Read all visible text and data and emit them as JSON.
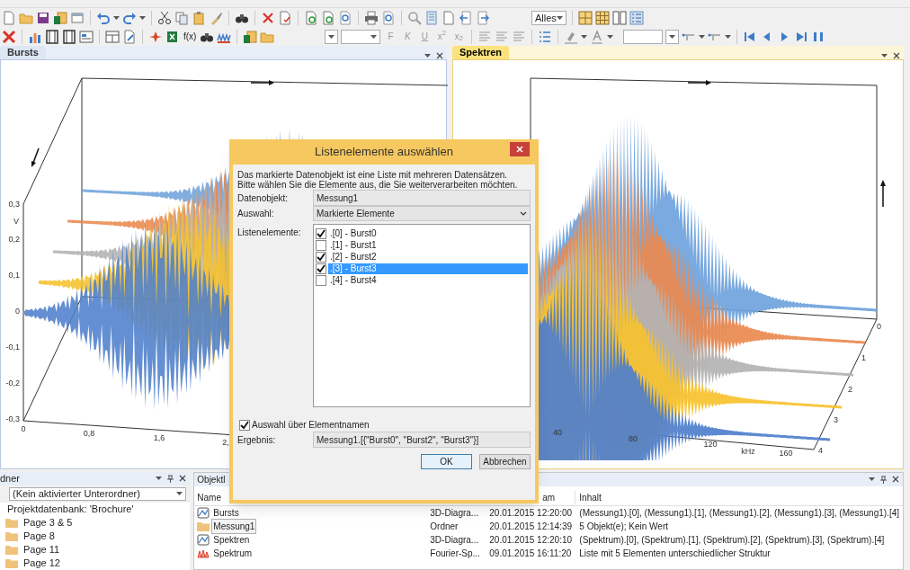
{
  "toolbar": {
    "filter_dropdown": {
      "value": "Alles"
    },
    "format_buttons": [
      "F",
      "K",
      "U",
      "x$^{2}$",
      "x$_{2}$"
    ],
    "function_button": "f(x)"
  },
  "left_panel": {
    "tab": {
      "label": "Bursts",
      "selected": false
    },
    "chart": {
      "y_ticks": [
        "0,3",
        "0,2",
        "0,1",
        "0",
        "-0,1",
        "-0,2",
        "-0,3"
      ],
      "y_unit": "V",
      "x_ticks": [
        "0",
        "0,8",
        "1,6",
        "2,"
      ]
    }
  },
  "right_panel": {
    "tab": {
      "label": "Spektren",
      "selected": true
    },
    "chart": {
      "x_ticks": [
        "40",
        "80",
        "120",
        "160"
      ],
      "x_unit": "kHz",
      "depth_ticks": [
        "0",
        "1",
        "2",
        "3",
        "4"
      ]
    }
  },
  "folder_panel": {
    "title": "dner",
    "dropdown": "(Kein aktivierter Unterordner)",
    "tree": [
      {
        "label": "Projektdatenbank: 'Brochure'",
        "kind": "root",
        "children": [
          {
            "label": "Page  3 & 5",
            "kind": "folder"
          },
          {
            "label": "Page  8",
            "kind": "folder"
          },
          {
            "label": "Page 11",
            "kind": "folder"
          },
          {
            "label": "Page 12",
            "kind": "folder"
          }
        ]
      }
    ]
  },
  "object_panel": {
    "title": "Objektl",
    "columns": [
      "Name",
      "am",
      "Inhalt"
    ],
    "rows": [
      {
        "kind": "chart3d",
        "name": "Bursts",
        "type": "3D-Diagra...",
        "date": "20.01.2015 12:20:00",
        "content": "(Messung1).[0], (Messung1).[1], (Messung1).[2], (Messung1).[3], (Messung1).[4]",
        "selected": false
      },
      {
        "kind": "folder",
        "name": "Messung1",
        "type": "Ordner",
        "date": "20.01.2015 12:14:39",
        "content": "5 Objekt(e); Kein Wert",
        "selected": true
      },
      {
        "kind": "chart3d",
        "name": "Spektren",
        "type": "3D-Diagra...",
        "date": "20.01.2015 12:20:10",
        "content": "(Spektrum).[0], (Spektrum).[1], (Spektrum).[2], (Spektrum).[3], (Spektrum).[4]",
        "selected": false
      },
      {
        "kind": "spectrum",
        "name": "Spektrum",
        "type": "Fourier-Sp...",
        "date": "09.01.2015 16:11:20",
        "content": "Liste mit 5 Elementen unterschiedlicher Struktur",
        "selected": false
      }
    ]
  },
  "dialog": {
    "title": "Listenelemente auswählen",
    "intro": [
      "Das markierte Datenobjekt ist eine Liste mit mehreren Datensätzen.",
      "Bitte wählen Sie die Elemente aus, die Sie weiterverarbeiten möchten."
    ],
    "data_object": {
      "label": "Datenobjekt:",
      "value": "Messung1"
    },
    "selection": {
      "label": "Auswahl:",
      "value": "Markierte Elemente"
    },
    "list_label": "Listenelemente:",
    "items": [
      {
        "label": ".[0] - Burst0",
        "checked": true,
        "selected": false
      },
      {
        "label": ".[1] - Burst1",
        "checked": false,
        "selected": false
      },
      {
        "label": ".[2] - Burst2",
        "checked": true,
        "selected": false
      },
      {
        "label": ".[3] - Burst3",
        "checked": true,
        "selected": true
      },
      {
        "label": ".[4] - Burst4",
        "checked": false,
        "selected": false
      }
    ],
    "by_name": {
      "label": "Auswahl über Elementnamen",
      "checked": true
    },
    "result": {
      "label": "Ergebnis:",
      "value": "Messung1.[{\"Burst0\", \"Burst2\", \"Burst3\"}]"
    },
    "buttons": [
      "OK",
      "Abbrechen"
    ]
  }
}
